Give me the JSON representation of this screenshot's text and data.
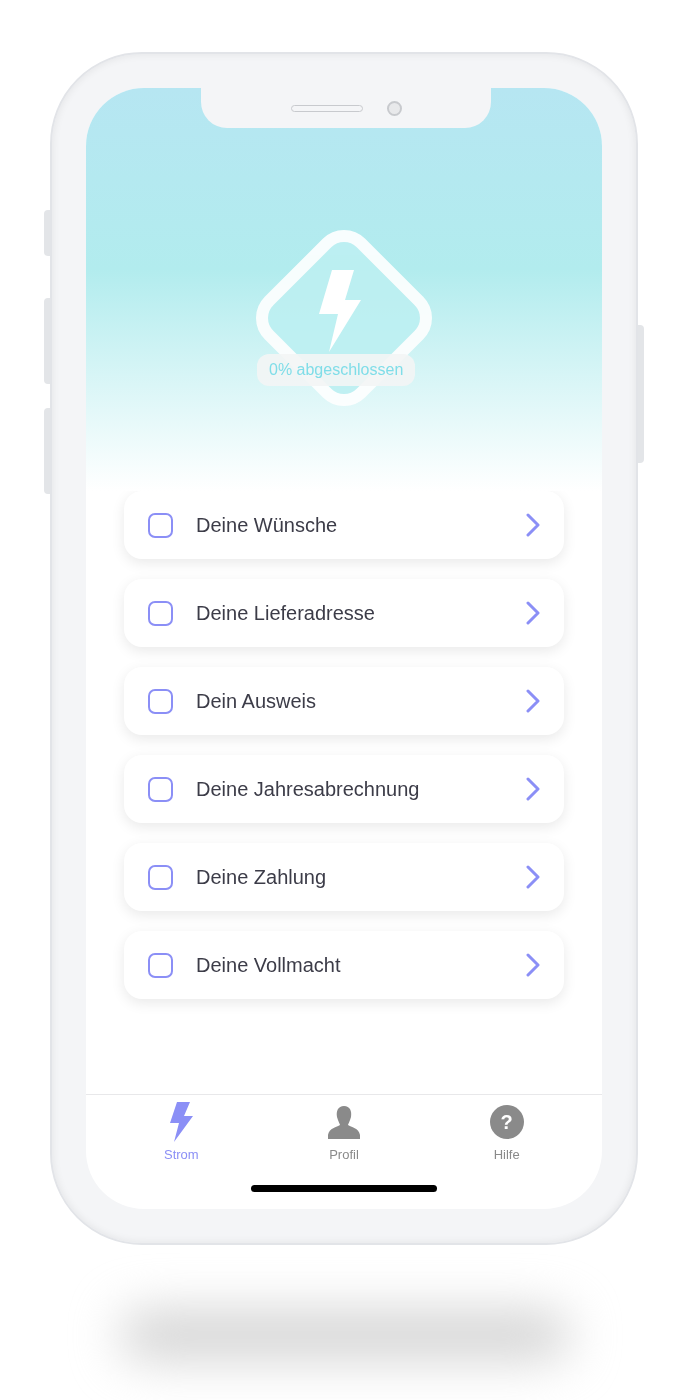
{
  "progress": {
    "label": "0% abgeschlossen"
  },
  "steps": [
    {
      "label": "Deine Wünsche",
      "checked": false
    },
    {
      "label": "Deine Lieferadresse",
      "checked": false
    },
    {
      "label": "Dein Ausweis",
      "checked": false
    },
    {
      "label": "Deine Jahresabrechnung",
      "checked": false
    },
    {
      "label": "Deine Zahlung",
      "checked": false
    },
    {
      "label": "Deine Vollmacht",
      "checked": false
    }
  ],
  "tabs": [
    {
      "kind": "bolt",
      "label": "Strom",
      "selected": true
    },
    {
      "kind": "person",
      "label": "Profil",
      "selected": false
    },
    {
      "kind": "help",
      "glyph": "?",
      "label": "Hilfe",
      "selected": false
    }
  ]
}
